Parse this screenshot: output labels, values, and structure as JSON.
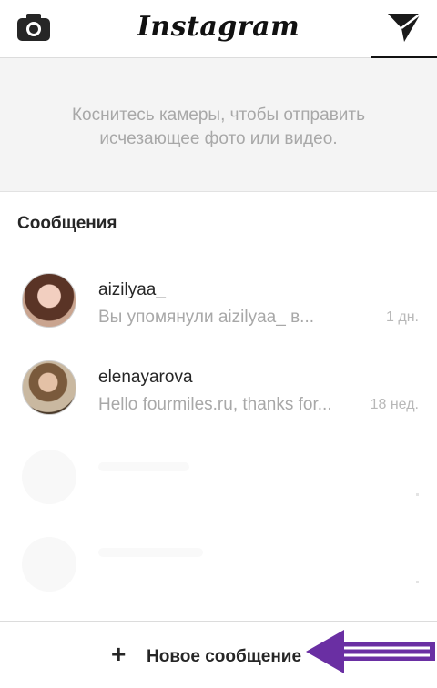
{
  "header": {
    "brand": "Instagram",
    "camera_icon": "camera-icon",
    "send_icon": "paper-plane-icon"
  },
  "hint": {
    "text": "Коснитесь камеры, чтобы отправить исчезающее фото или видео."
  },
  "messages": {
    "title": "Сообщения",
    "threads": [
      {
        "name": "aizilyaa_",
        "preview": "Вы упомянули aizilyaa_ в...",
        "time": "1 дн."
      },
      {
        "name": "elenayarova",
        "preview": "Hello  fourmiles.ru, thanks  for...",
        "time": "18 нед."
      }
    ]
  },
  "footer": {
    "plus_icon": "+",
    "new_message_label": "Новое сообщение"
  },
  "annotation": {
    "arrow_color": "#6a2fa3"
  }
}
